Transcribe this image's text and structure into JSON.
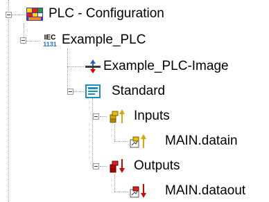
{
  "tree": {
    "root": {
      "label": "PLC - Configuration",
      "icon": "plc-configuration-icon",
      "expanded": true
    },
    "project": {
      "label": "Example_PLC",
      "icon": "iec-1131-icon",
      "expanded": true
    },
    "image": {
      "label": "Example_PLC-Image",
      "icon": "process-image-icon"
    },
    "standard": {
      "label": "Standard",
      "icon": "task-standard-icon",
      "expanded": true
    },
    "inputs": {
      "label": "Inputs",
      "icon": "inputs-icon",
      "expanded": true
    },
    "input_var": {
      "label": "MAIN.datain",
      "icon": "input-variable-icon"
    },
    "outputs": {
      "label": "Outputs",
      "icon": "outputs-icon",
      "expanded": true
    },
    "output_var": {
      "label": "MAIN.dataout",
      "icon": "output-variable-icon"
    }
  },
  "colors": {
    "tree_line": "#9a9a9a",
    "input_arrow": "#d4a800",
    "output_arrow": "#d40000",
    "standard_icon": "#1a8fbf"
  }
}
